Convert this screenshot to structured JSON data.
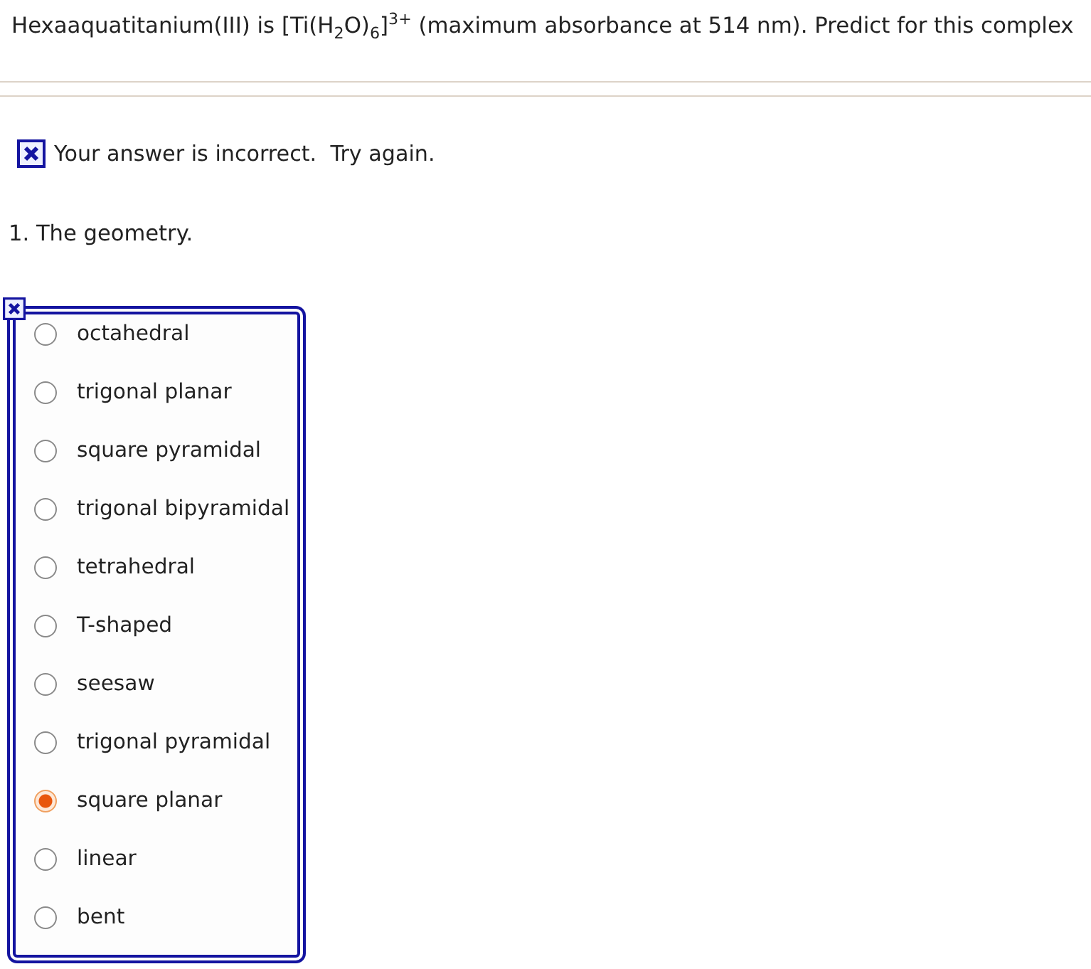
{
  "question": {
    "text": "Hexaaquatitanium(III) is [Ti(H$_{2}$O)$_{6}$]$^{3+}$ (maximum absorbance at 514 nm). Predict for this complex"
  },
  "feedback": {
    "correct": false,
    "text": "Your answer is incorrect.  Try again."
  },
  "part": {
    "prompt": "1. The geometry.",
    "correct": false,
    "options": [
      {
        "label": "octahedral",
        "selected": false
      },
      {
        "label": "trigonal planar",
        "selected": false
      },
      {
        "label": "square pyramidal",
        "selected": false
      },
      {
        "label": "trigonal bipyramidal",
        "selected": false
      },
      {
        "label": "tetrahedral",
        "selected": false
      },
      {
        "label": "T-shaped",
        "selected": false
      },
      {
        "label": "seesaw",
        "selected": false
      },
      {
        "label": "trigonal pyramidal",
        "selected": false
      },
      {
        "label": "square planar",
        "selected": true
      },
      {
        "label": "linear",
        "selected": false
      },
      {
        "label": "bent",
        "selected": false
      }
    ]
  }
}
